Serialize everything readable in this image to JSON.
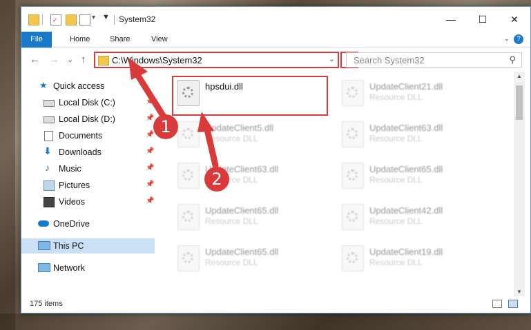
{
  "window": {
    "title": "System32",
    "minimize": "—",
    "maximize": "☐",
    "close": "✕"
  },
  "ribbon": {
    "tabs": [
      "File",
      "Home",
      "Share",
      "View"
    ],
    "help": "?"
  },
  "navigation": {
    "back": "←",
    "forward": "→",
    "recent": "⌄",
    "up": "↑",
    "address_path": "C:\\Windows\\System32",
    "address_dropdown": "⌄",
    "refresh": "↻",
    "search_placeholder": "Search System32",
    "search_icon": "⚲"
  },
  "sidebar": {
    "items": [
      {
        "label": "Quick access",
        "icon": "star-icon",
        "pinned": false
      },
      {
        "label": "Local Disk (C:)",
        "icon": "drive-icon",
        "pinned": true
      },
      {
        "label": "Local Disk (D:)",
        "icon": "drive-icon",
        "pinned": true
      },
      {
        "label": "Documents",
        "icon": "document-icon",
        "pinned": true
      },
      {
        "label": "Downloads",
        "icon": "download-icon",
        "pinned": true
      },
      {
        "label": "Music",
        "icon": "music-icon",
        "pinned": true
      },
      {
        "label": "Pictures",
        "icon": "picture-icon",
        "pinned": true
      },
      {
        "label": "Videos",
        "icon": "video-icon",
        "pinned": true
      },
      {
        "label": "OneDrive",
        "icon": "cloud-icon",
        "pinned": false
      },
      {
        "label": "This PC",
        "icon": "computer-icon",
        "pinned": false,
        "selected": true
      },
      {
        "label": "Network",
        "icon": "network-icon",
        "pinned": false
      }
    ],
    "pin_glyph": "📌"
  },
  "files": [
    {
      "name": "hpsdui.dll",
      "type": "",
      "highlighted": true
    },
    {
      "name": "UpdateClient21.dll",
      "type": "Resource DLL"
    },
    {
      "name": "UpdateClient5.dll",
      "type": "Resource DLL"
    },
    {
      "name": "UpdateClient63.dll",
      "type": "Resource DLL"
    },
    {
      "name": "UpdateClient63.dll",
      "type": "Resource DLL"
    },
    {
      "name": "UpdateClient65.dll",
      "type": "Resource DLL"
    },
    {
      "name": "UpdateClient65.dll",
      "type": "Resource DLL"
    },
    {
      "name": "UpdateClient42.dll",
      "type": "Resource DLL"
    },
    {
      "name": "UpdateClient65.dll",
      "type": "Resource DLL"
    },
    {
      "name": "UpdateClient19.dll",
      "type": "Resource DLL"
    }
  ],
  "status": {
    "item_count": "175 items"
  },
  "annotations": {
    "badge1": "1",
    "badge2": "2",
    "color": "#d93a3a"
  }
}
